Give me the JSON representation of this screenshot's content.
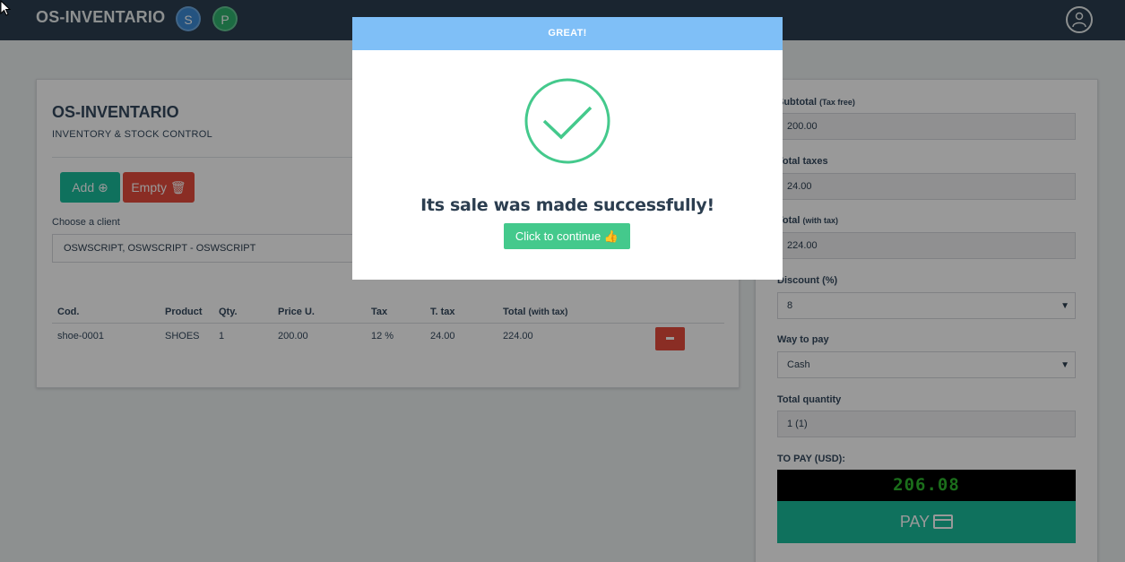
{
  "topbar": {
    "brand": "OS-INVENTARIO",
    "badge_s": "S",
    "badge_p": "P"
  },
  "left_panel": {
    "title": "OS-INVENTARIO",
    "subtitle": "INVENTORY & STOCK CONTROL",
    "add_label": "Add",
    "empty_label": "Empty",
    "client_label": "Choose a client",
    "client_value": "OSWSCRIPT, OSWSCRIPT - OSWSCRIPT"
  },
  "cart": {
    "headers": {
      "cod": "Cod.",
      "product": "Product",
      "qty": "Qty.",
      "price": "Price U.",
      "tax": "Tax",
      "ttax": "T. tax",
      "total": "Total",
      "total_note": "(with tax)"
    },
    "rows": [
      {
        "cod": "shoe-0001",
        "product": "SHOES",
        "qty": "1",
        "price": "200.00",
        "tax": "12 %",
        "ttax": "24.00",
        "total": "224.00"
      }
    ]
  },
  "summary": {
    "subtotal_label": "Subtotal",
    "subtotal_note": "(Tax free)",
    "subtotal_value": "200.00",
    "taxes_label": "Total taxes",
    "taxes_value": "24.00",
    "total_label": "Total",
    "total_note": "(with tax)",
    "total_value": "224.00",
    "discount_label": "Discount (%)",
    "discount_value": "8",
    "way_label": "Way to pay",
    "way_value": "Cash",
    "qty_label": "Total quantity",
    "qty_value": "1 (1)",
    "topay_label": "TO PAY (USD):",
    "topay_value": "206.08",
    "pay_label": "PAY"
  },
  "modal": {
    "header": "GREAT!",
    "message": "Its sale was made successfully!",
    "continue_label": "Click to continue"
  },
  "colors": {
    "success": "#44c98c",
    "danger": "#e74c3c",
    "teal": "#1abc9c",
    "modal_header": "#7fbff7"
  }
}
